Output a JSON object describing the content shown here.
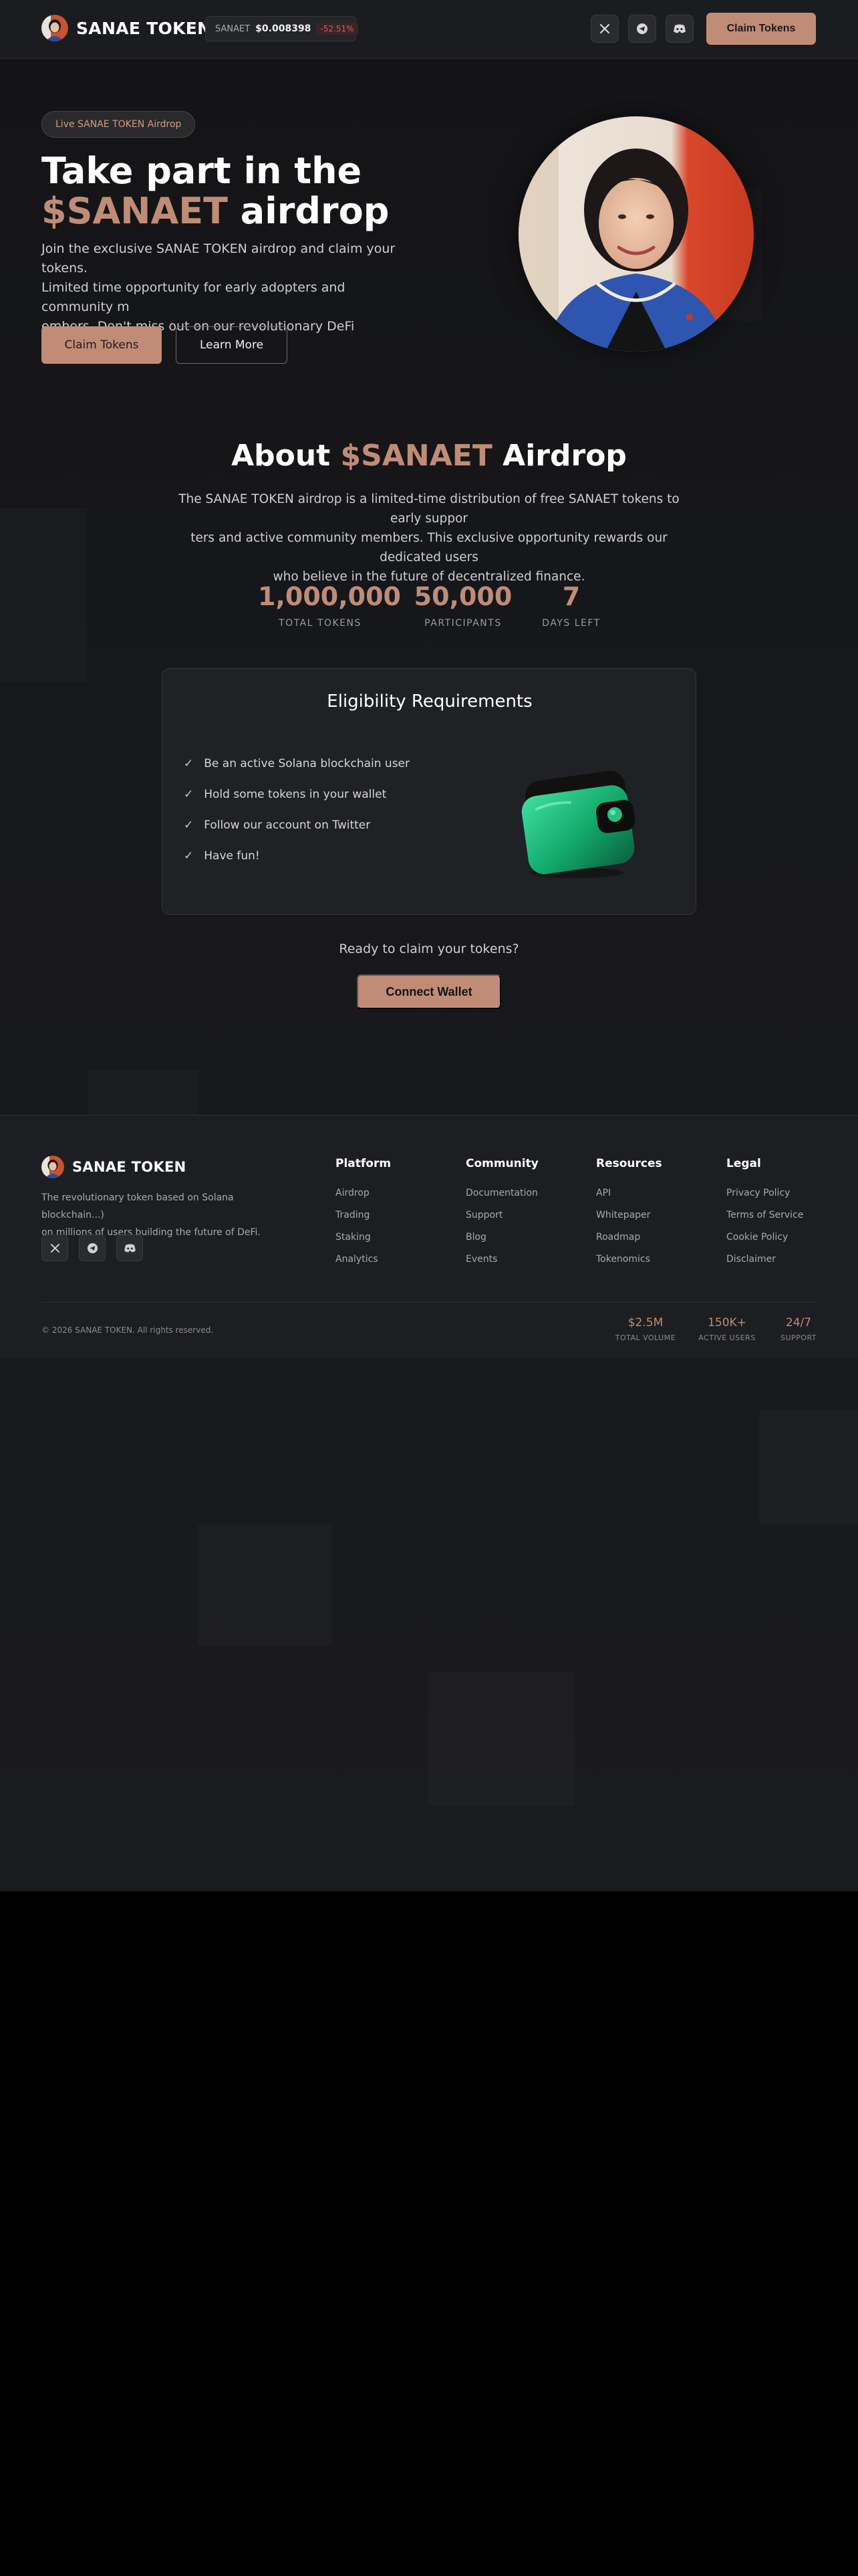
{
  "header": {
    "logo_text": "SANAE TOKEN",
    "ticker": {
      "symbol": "SANAET",
      "price": "$0.008398",
      "change": "-52.51%"
    },
    "social_icons": [
      "x-icon",
      "telegram-icon",
      "discord-icon"
    ],
    "claim_label": "Claim Tokens"
  },
  "hero": {
    "badge": "Live SANAE TOKEN Airdrop",
    "title_line1": "Take part in the",
    "title_accent": "$SANAET",
    "title_rest": " airdrop",
    "description_lines": [
      "Join the exclusive SANAE TOKEN airdrop and claim your tokens.",
      "Limited time opportunity for early adopters and community m",
      "embers. Don't miss out on our revolutionary DeFi project."
    ],
    "primary_button": "Claim Tokens",
    "secondary_button": "Learn More"
  },
  "about": {
    "title_pre": "About ",
    "title_accent": "$SANAET",
    "title_post": " Airdrop",
    "description_lines": [
      "The SANAE TOKEN airdrop is a limited-time distribution of free SANAET tokens to early suppor",
      "ters and active community members. This exclusive opportunity rewards our dedicated users",
      "who believe in the future of decentralized finance."
    ],
    "stats": [
      {
        "value": "1,000,000",
        "label": "TOTAL TOKENS"
      },
      {
        "value": "50,000",
        "label": "PARTICIPANTS"
      },
      {
        "value": "7",
        "label": "DAYS LEFT"
      }
    ]
  },
  "eligibility": {
    "title": "Eligibility Requirements",
    "items": [
      "Be an active Solana blockchain user",
      "Hold some tokens in your wallet",
      "Follow our account on Twitter",
      "Have fun!"
    ]
  },
  "cta": {
    "ready_text": "Ready to claim your tokens?",
    "connect_label": "Connect Wallet"
  },
  "footer": {
    "logo_text": "SANAE TOKEN",
    "description_lines": [
      "The revolutionary token based on Solana blockchain...)",
      "on millions of users building the future of DeFi."
    ],
    "columns": [
      {
        "title": "Platform",
        "links": [
          "Airdrop",
          "Trading",
          "Staking",
          "Analytics"
        ]
      },
      {
        "title": "Community",
        "links": [
          "Documentation",
          "Support",
          "Blog",
          "Events"
        ]
      },
      {
        "title": "Resources",
        "links": [
          "API",
          "Whitepaper",
          "Roadmap",
          "Tokenomics"
        ]
      },
      {
        "title": "Legal",
        "links": [
          "Privacy Policy",
          "Terms of Service",
          "Cookie Policy",
          "Disclaimer"
        ]
      }
    ],
    "copyright": "© 2026 SANAE TOKEN. All rights reserved.",
    "stats": [
      {
        "value": "$2.5M",
        "label": "TOTAL VOLUME"
      },
      {
        "value": "150K+",
        "label": "ACTIVE USERS"
      },
      {
        "value": "24/7",
        "label": "SUPPORT"
      }
    ]
  },
  "colors": {
    "accent": "#c08c76",
    "background": "#141416",
    "negative": "#e0595b"
  }
}
